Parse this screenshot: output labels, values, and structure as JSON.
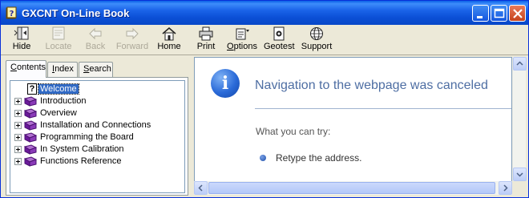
{
  "window": {
    "title": "GXCNT On-Line Book",
    "icon": "help-book-icon",
    "controls": [
      "minimize",
      "maximize",
      "close"
    ]
  },
  "toolbar": {
    "hide": "Hide",
    "locate": "Locate",
    "back": "Back",
    "forward": "Forward",
    "home": "Home",
    "print": "Print",
    "options_u": "O",
    "options_rest": "ptions",
    "geotest": "Geotest",
    "support": "Support"
  },
  "tabs": {
    "contents_u": "C",
    "contents_rest": "ontents",
    "index_u": "I",
    "index_rest": "ndex",
    "search_u": "S",
    "search_rest": "earch"
  },
  "tree": {
    "items": [
      {
        "label": "Welcome",
        "icon": "help-page-icon",
        "selected": true
      },
      {
        "label": "Introduction",
        "icon": "book-icon"
      },
      {
        "label": "Overview",
        "icon": "book-icon"
      },
      {
        "label": "Installation and Connections",
        "icon": "book-icon"
      },
      {
        "label": "Programming the Board",
        "icon": "book-icon"
      },
      {
        "label": "In System Calibration",
        "icon": "book-icon"
      },
      {
        "label": "Functions Reference",
        "icon": "book-icon"
      }
    ]
  },
  "content": {
    "title": "Navigation to the webpage was canceled",
    "try_label": "What you can try:",
    "try_items": [
      "Retype the address."
    ]
  },
  "colors": {
    "title_bar": "#0b4fd6",
    "selection": "#316ac5",
    "error_title": "#4e6ea3"
  }
}
